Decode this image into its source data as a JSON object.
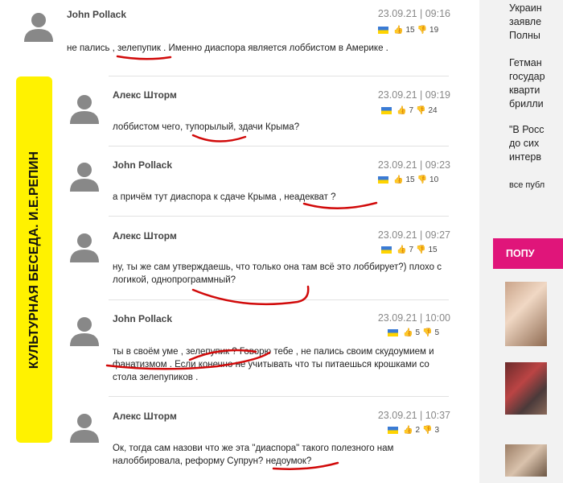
{
  "comments": [
    {
      "author": "John Pollack",
      "date": "23.09.21 | 09:16",
      "likes": "15",
      "dislikes": "19",
      "text": "не пались , зелепупик . Именно диаспора является лоббистом в Америке ."
    },
    {
      "author": "Алекс Шторм",
      "date": "23.09.21 | 09:19",
      "likes": "7",
      "dislikes": "24",
      "text": "лоббистом чего, тупорылый, здачи Крыма?"
    },
    {
      "author": "John Pollack",
      "date": "23.09.21 | 09:23",
      "likes": "15",
      "dislikes": "10",
      "text": "а причём тут диаспора к сдаче Крыма , неадекват ?"
    },
    {
      "author": "Алекс Шторм",
      "date": "23.09.21 | 09:27",
      "likes": "7",
      "dislikes": "15",
      "text": "ну, ты же сам утверждаешь, что только она там всё это лоббирует?) плохо с логикой, однопрограммный?"
    },
    {
      "author": "John Pollack",
      "date": "23.09.21 | 10:00",
      "likes": "5",
      "dislikes": "5",
      "text": "ты в своём уме , зелепупик ? Говорю тебе , не пались своим скудоумием и фанатизмом . Если конечно не учитывать что ты питаешься крошками со стола зелепупиков ."
    },
    {
      "author": "Алекс Шторм",
      "date": "23.09.21 | 10:37",
      "likes": "2",
      "dislikes": "3",
      "text": "Ок, тогда сам назови что же эта \"диаспора\" такого полезного нам налоббировала, реформу Супрун? недоумок?"
    }
  ],
  "banner": "КУЛЬТУРНАЯ БЕСЕДА. И.Е.РЕПИН",
  "sidebar": {
    "news": [
      "Украин\nзаявле\nПолны",
      "Гетман\nгосудар\nкварти\nбрилли",
      "\"В Росс\nдо сих\nинтерв"
    ],
    "all_publications": "все публ",
    "popular": "ПОПУ"
  },
  "colors": {
    "accent": "#e0157a",
    "banner": "#fff200",
    "annotation": "#d10a0a"
  },
  "icons": [
    "avatar-silhouette-icon",
    "ukraine-flag-icon",
    "thumbs-up-icon",
    "thumbs-down-icon"
  ]
}
